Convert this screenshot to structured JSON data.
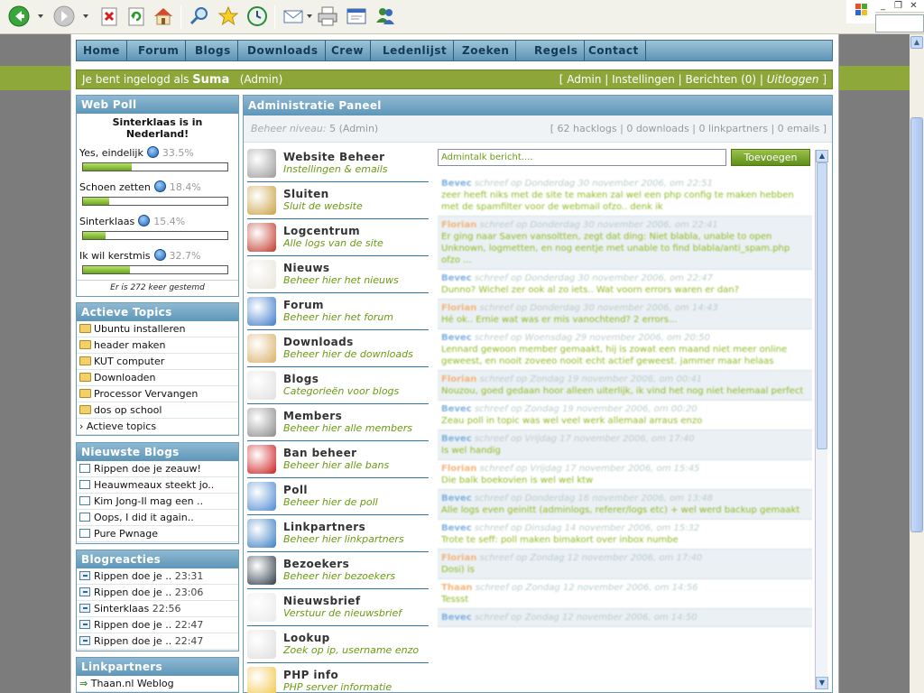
{
  "nav": [
    "Home",
    "Forum",
    "Blogs",
    "Downloads",
    "Crew",
    "Ledenlijst",
    "Zoeken",
    "Regels",
    "Contact"
  ],
  "login": {
    "prefix": "Je bent ingelogd als",
    "user": "Suma",
    "role": "(Admin)",
    "links": [
      "Admin",
      "Instellingen",
      "Berichten (0)",
      "Uitloggen"
    ]
  },
  "poll": {
    "title": "Web Poll",
    "question": "Sinterklaas is in Nederland!",
    "options": [
      {
        "label": "Yes, eindelijk",
        "pct": "33.5%",
        "value": 0.335
      },
      {
        "label": "Schoen zetten",
        "pct": "18.4%",
        "value": 0.184
      },
      {
        "label": "Sinterklaas",
        "pct": "15.4%",
        "value": 0.154
      },
      {
        "label": "Ik wil kerstmis",
        "pct": "32.7%",
        "value": 0.327
      }
    ],
    "footer": "Er is 272 keer gestemd"
  },
  "topics": {
    "title": "Actieve Topics",
    "items": [
      "Ubuntu installeren",
      "header maken",
      "KUT computer",
      "Downloaden",
      "Processor Vervangen",
      "dos op school"
    ],
    "more": "› Actieve topics"
  },
  "blogs": {
    "title": "Nieuwste Blogs",
    "items": [
      "Rippen doe je zeauw!",
      "Heauwmeaux steekt jo..",
      "Kim Jong-Il mag een ..",
      "Oops, I did it again..",
      "Pure Pwnage"
    ]
  },
  "reactions": {
    "title": "Blogreacties",
    "items": [
      {
        "text": "Rippen doe je ..",
        "time": "23:31"
      },
      {
        "text": "Rippen doe je ..",
        "time": "23:06"
      },
      {
        "text": "Sinterklaas",
        "time": "22:56"
      },
      {
        "text": "Rippen doe je ..",
        "time": "22:47"
      },
      {
        "text": "Rippen doe je ..",
        "time": "22:47"
      }
    ]
  },
  "partners": {
    "title": "Linkpartners",
    "items": [
      "Thaan.nl Weblog"
    ]
  },
  "admin": {
    "title": "Administratie Paneel",
    "level_label": "Beheer niveau:",
    "level": "5 (Admin)",
    "stats": "[ 62 hacklogs | 0 downloads | 0 linkpartners | 0 emails ]",
    "items": [
      {
        "title": "Website Beheer",
        "sub": "Instellingen & emails",
        "icon": "gears-icon",
        "color": "#9a9a9a"
      },
      {
        "title": "Sluiten",
        "sub": "Sluit de website",
        "icon": "lock-icon",
        "color": "#c9a243"
      },
      {
        "title": "Logcentrum",
        "sub": "Alle logs van de site",
        "icon": "books-icon",
        "color": "#c0392b"
      },
      {
        "title": "Nieuws",
        "sub": "Beheer hier het nieuws",
        "icon": "pencil-paper-icon",
        "color": "#e8e4da"
      },
      {
        "title": "Forum",
        "sub": "Beheer hier het forum",
        "icon": "monitor-icon",
        "color": "#3d7cc9"
      },
      {
        "title": "Downloads",
        "sub": "Beheer hier de downloads",
        "icon": "box-download-icon",
        "color": "#d9b06a"
      },
      {
        "title": "Blogs",
        "sub": "Categorieën voor blogs",
        "icon": "notepad-icon",
        "color": "#e0e0e0"
      },
      {
        "title": "Members",
        "sub": "Beheer hier alle members",
        "icon": "users-icon",
        "color": "#8a8a8a"
      },
      {
        "title": "Ban beheer",
        "sub": "Beheer hier alle bans",
        "icon": "red-x-icon",
        "color": "#cc1f1f"
      },
      {
        "title": "Poll",
        "sub": "Beheer hier de poll",
        "icon": "chart-icon",
        "color": "#4e8ad0"
      },
      {
        "title": "Linkpartners",
        "sub": "Beheer hier linkpartners",
        "icon": "globe-icon",
        "color": "#3a7fc2"
      },
      {
        "title": "Bezoekers",
        "sub": "Beheer hier bezoekers",
        "icon": "dial-icon",
        "color": "#2d3b48"
      },
      {
        "title": "Nieuwsbrief",
        "sub": "Verstuur de nieuwsbrief",
        "icon": "letter-arrow-icon",
        "color": "#eaeaea"
      },
      {
        "title": "Lookup",
        "sub": "Zoek op ip, username enzo",
        "icon": "magnifier-icon",
        "color": "#dedede"
      },
      {
        "title": "PHP info",
        "sub": "PHP server informatie",
        "icon": "info-icon",
        "color": "#f2c54a"
      }
    ],
    "talk_placeholder": "Admintalk bericht....",
    "talk_button": "Toevoegen"
  },
  "talk": [
    {
      "name": "Bevec",
      "meta": "schreef op Donderdag 30 november 2006, om 22:51",
      "msg": "zeer  heeft niks met de site te maken  zal wel een php config te maken hebben met de spamfilter voor de webmail ofzo.. denk ik",
      "kind": "b"
    },
    {
      "name": "Florian",
      "meta": "schreef op Donderdag 30 november 2006, om 22:41",
      "msg": "Er ging naar Saven vansoltten, zegt dat ding: Niet blabla, unable to open Unknown, logmetten, en nog eentje met unable to find blabla/anti_spam.php ofzo ...",
      "kind": "f"
    },
    {
      "name": "Bevec",
      "meta": "schreef op Donderdag 30 november 2006, om 22:47",
      "msg": "Dunno?  Wichel zer ook al zo iets.. Wat voorn errors waren er dan?",
      "kind": "b"
    },
    {
      "name": "Florian",
      "meta": "schreef op Donderdag 30 november 2006, om 14:43",
      "msg": "Hé ok.. Ernie wat was er mis vanochtend? 2 errors...",
      "kind": "f"
    },
    {
      "name": "Bevec",
      "meta": "schreef op Woensdag 29 november 2006, om 20:50",
      "msg": "Lennard gewoon member gemaakt, hij is zowat een maand niet meer online geweest, en nooit zoveeo nooit echt actief geweest. jammer maar helaas",
      "kind": "b"
    },
    {
      "name": "Florian",
      "meta": "schreef op Zondag 19 november 2006, om 00:41",
      "msg": "Nouzou, goed gedaan hoor  alleen uiterlijk, ik vind het nog niet helemaal perfect",
      "kind": "f"
    },
    {
      "name": "Bevec",
      "meta": "schreef op Zondag 19 november 2006, om 00:20",
      "msg": "Zeau  poll in topic was wel veel werk  allemaal arraus enzo",
      "kind": "b"
    },
    {
      "name": "Bevec",
      "meta": "schreef op Vrijdag 17 november 2006, om 17:40",
      "msg": "Is  wel handig",
      "kind": "b"
    },
    {
      "name": "Florian",
      "meta": "schreef op Vrijdag 17 november 2006, om 15:45",
      "msg": "Die balk boekovien is wel wel ktw",
      "kind": "f"
    },
    {
      "name": "Bevec",
      "meta": "schreef op Donderdag 16 november 2006, om 13:48",
      "msg": "Alle logs even geinitt (adminlogs, referer/logs etc) + wel werd backup gemaakt",
      "kind": "b"
    },
    {
      "name": "Bevec",
      "meta": "schreef op Dinsdag 14 november 2006, om 15:32",
      "msg": "Trote te seff: poll maken bimakort over inbox numbe",
      "kind": "b"
    },
    {
      "name": "Florian",
      "meta": "schreef op Zondag 12 november 2006, om 17:40",
      "msg": "Dosi) is ",
      "kind": "f"
    },
    {
      "name": "Thaan",
      "meta": "schreef op Zondag 12 november 2006, om 14:56",
      "msg": "Tessst",
      "kind": "f"
    },
    {
      "name": "Bevec",
      "meta": "schreef op Zondag 12 november 2006, om 14:50",
      "msg": "",
      "kind": "b"
    }
  ],
  "colors": {
    "accent": "#5e96b8",
    "green": "#8ca63a",
    "link_green": "#6a9a12"
  }
}
